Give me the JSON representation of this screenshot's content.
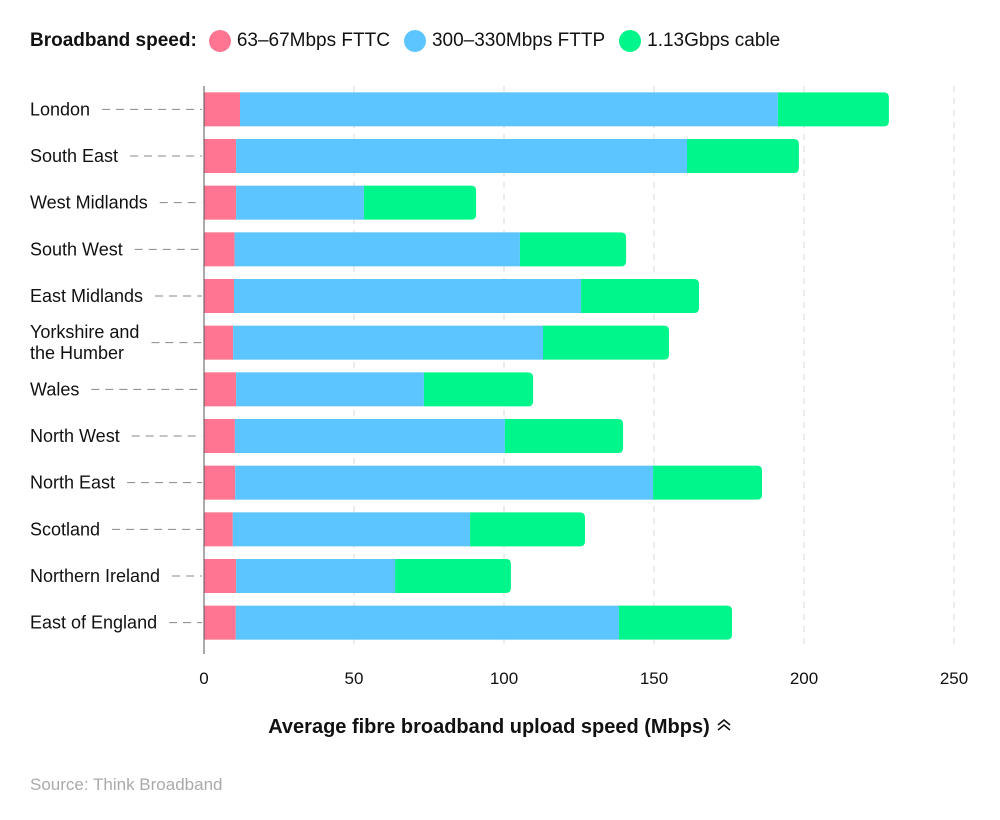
{
  "chart_data": {
    "type": "bar",
    "orientation": "horizontal",
    "stacked": true,
    "title": "",
    "legend_title": "Broadband speed:",
    "legend_position": "top-left",
    "categories": [
      "London",
      "South East",
      "West Midlands",
      "South West",
      "East Midlands",
      "Yorkshire and the Humber",
      "Wales",
      "North West",
      "North East",
      "Scotland",
      "Northern Ireland",
      "East of England"
    ],
    "category_lines": [
      [
        "London"
      ],
      [
        "South East"
      ],
      [
        "West Midlands"
      ],
      [
        "South West"
      ],
      [
        "East Midlands"
      ],
      [
        "Yorkshire and",
        "the Humber"
      ],
      [
        "Wales"
      ],
      [
        "North West"
      ],
      [
        "North East"
      ],
      [
        "Scotland"
      ],
      [
        "Northern Ireland"
      ],
      [
        "East of England"
      ]
    ],
    "series": [
      {
        "name": "63–67Mbps FTTC",
        "color": "#ff7592",
        "values": [
          12,
          10.7,
          10.7,
          10.2,
          10,
          9.7,
          10.7,
          10.3,
          10.4,
          9.6,
          10.7,
          10.6
        ]
      },
      {
        "name": "300–330Mbps FTTP",
        "color": "#5cc5ff",
        "values": [
          179.3,
          150.3,
          42.6,
          95.1,
          115.7,
          103.3,
          62.6,
          90,
          139.3,
          79.1,
          53,
          127.7
        ]
      },
      {
        "name": "1.13Gbps cable",
        "color": "#00f58b",
        "values": [
          37,
          37.3,
          37.4,
          35.4,
          39.3,
          42,
          36.4,
          39.4,
          36.3,
          38.3,
          38.6,
          37.7
        ]
      }
    ],
    "xlabel": "Average fibre broadband upload speed (Mbps)",
    "ylabel": "",
    "xlim": [
      0,
      250
    ],
    "xticks": [
      0,
      50,
      100,
      150,
      200,
      250
    ],
    "grid": true
  },
  "xlabel_icon": "double-chevron-up-icon",
  "source": "Source: Think Broadband"
}
